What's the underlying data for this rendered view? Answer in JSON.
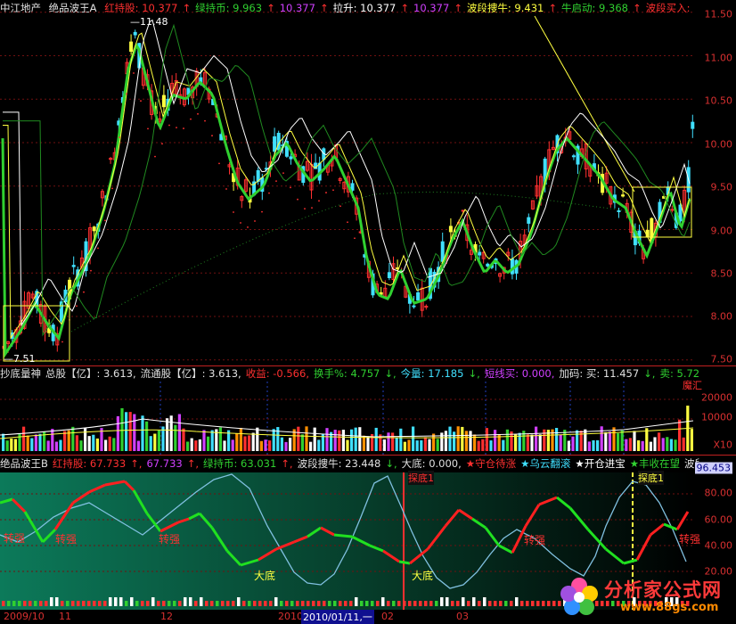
{
  "main_header": {
    "stock_name": "中江地产",
    "indicator": "绝品波王A",
    "items": [
      {
        "text": "红持股: 10.377",
        "color": "#ff3030"
      },
      {
        "text": "↑",
        "color": "#ff3030"
      },
      {
        "text": "绿持币: 9.963",
        "color": "#30d030"
      },
      {
        "text": "↑",
        "color": "#ff3030"
      },
      {
        "text": "10.377",
        "color": "#d040ff"
      },
      {
        "text": "↑",
        "color": "#ff3030"
      },
      {
        "text": "拉升: 10.377",
        "color": "#ffffff"
      },
      {
        "text": "↑",
        "color": "#ff3030"
      },
      {
        "text": "10.377",
        "color": "#d040ff"
      },
      {
        "text": "↑",
        "color": "#ff3030"
      },
      {
        "text": "波段捜牛: 9.431",
        "color": "#ffff40"
      },
      {
        "text": "↑",
        "color": "#ff3030"
      },
      {
        "text": "牛启动: 9.368",
        "color": "#30d030"
      },
      {
        "text": "↑",
        "color": "#ff3030"
      },
      {
        "text": "波段买入:",
        "color": "#ff3030"
      },
      {
        "text": "波段卖出:",
        "color": "#30d030"
      }
    ],
    "high_label": "11.48",
    "low_label": "7.51"
  },
  "price_axis": [
    "11.50",
    "11.00",
    "10.50",
    "10.00",
    "9.50",
    "9.00",
    "8.50",
    "8.00",
    "7.50"
  ],
  "volume_header": {
    "items": [
      {
        "text": "抄底量神",
        "color": "#e0e0e0"
      },
      {
        "text": "总股【亿】: 3.613,",
        "color": "#e0e0e0"
      },
      {
        "text": "流通股【亿】: 3.613,",
        "color": "#e0e0e0"
      },
      {
        "text": "收益: -0.566,",
        "color": "#ff3030"
      },
      {
        "text": "换手%: 4.757",
        "color": "#30d030"
      },
      {
        "text": "↓,",
        "color": "#30d030"
      },
      {
        "text": "今量: 17.185",
        "color": "#40e0ff"
      },
      {
        "text": "↓,",
        "color": "#30d030"
      },
      {
        "text": "短线买: 0.000,",
        "color": "#d040ff"
      },
      {
        "text": "加码: 买: 11.457",
        "color": "#e0e0e0"
      },
      {
        "text": "↓,",
        "color": "#30d030"
      },
      {
        "text": "卖: 5.728",
        "color": "#30d030"
      },
      {
        "text": "↓,",
        "color": "#30d030"
      },
      {
        "text": "空头",
        "color": "#40e0ff"
      }
    ],
    "corner_label": "魔汇"
  },
  "volume_axis": [
    "20000",
    "10000",
    "X10"
  ],
  "wave_header": {
    "items": [
      {
        "text": "绝品波王B",
        "color": "#e0e0e0"
      },
      {
        "text": "红持股: 67.733",
        "color": "#ff3030"
      },
      {
        "text": "↑,",
        "color": "#ff3030"
      },
      {
        "text": "67.733",
        "color": "#d040ff"
      },
      {
        "text": "↑,",
        "color": "#ff3030"
      },
      {
        "text": "绿持币: 63.031",
        "color": "#30d030"
      },
      {
        "text": "↑,",
        "color": "#ff3030"
      },
      {
        "text": "波段捜牛: 23.448",
        "color": "#e0e0e0"
      },
      {
        "text": "↓,",
        "color": "#30d030"
      },
      {
        "text": "大底: 0.000,",
        "color": "#e0e0e0"
      },
      {
        "text": "★守仓待涨",
        "color": "#ff3030"
      },
      {
        "text": "★乌云翻滚",
        "color": "#40e0ff"
      },
      {
        "text": "★开仓进宝",
        "color": "#ffffff"
      },
      {
        "text": "★丰收在望",
        "color": "#30d030"
      },
      {
        "text": "波段买",
        "color": "#e0e0e0"
      }
    ]
  },
  "wave_axis": [
    "96.453",
    "80.00",
    "60.00",
    "40.00",
    "20.00"
  ],
  "wave_labels": [
    {
      "text": "转强",
      "color": "#ff3030"
    },
    {
      "text": "转强",
      "color": "#ff3030"
    },
    {
      "text": "转强",
      "color": "#ff3030"
    },
    {
      "text": "大底",
      "color": "#ffff40"
    },
    {
      "text": "大底",
      "color": "#ffff40"
    },
    {
      "text": "探底1",
      "color": "#ff3030"
    },
    {
      "text": "转强",
      "color": "#ff3030"
    },
    {
      "text": "探底1",
      "color": "#ffff40"
    },
    {
      "text": "转强",
      "color": "#ff3030"
    }
  ],
  "date_axis": {
    "labels": [
      "2009/10",
      "11",
      "12",
      "2010",
      "02",
      "03"
    ],
    "highlight": "2010/01/11,一"
  },
  "watermark": {
    "title": "分析家公式网",
    "url": "www.88gs.com"
  },
  "colors": {
    "up": "#ff3030",
    "down": "#40e0ff",
    "green_line": "#30d030",
    "yellow_line": "#ffff40",
    "axis_text": "#d83030",
    "wave_bg_dark": "#0a3a2a"
  }
}
